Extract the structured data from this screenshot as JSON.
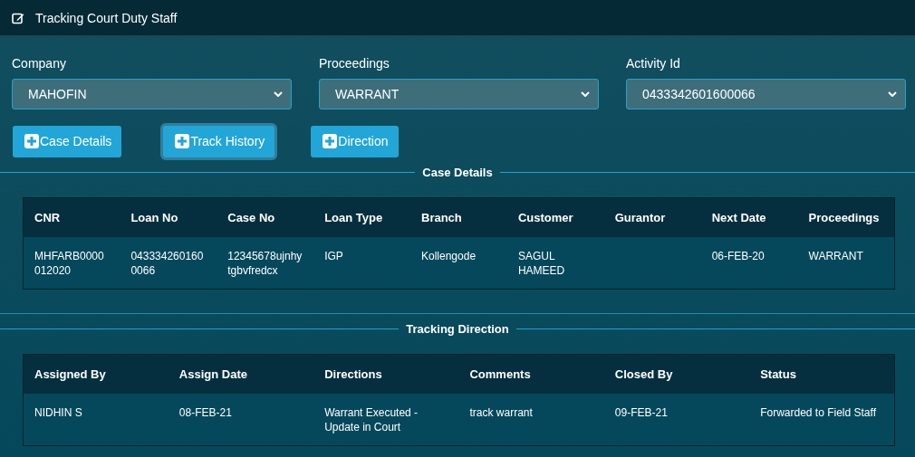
{
  "window": {
    "title": "Tracking Court Duty Staff"
  },
  "filters": [
    {
      "label": "Company",
      "value": "MAHOFIN"
    },
    {
      "label": "Proceedings",
      "value": "WARRANT"
    },
    {
      "label": "Activity Id",
      "value": "0433342601600066"
    }
  ],
  "buttons": [
    {
      "label": "Case Details",
      "focused": false
    },
    {
      "label": "Track History",
      "focused": true
    },
    {
      "label": "Direction",
      "focused": false
    }
  ],
  "case_details": {
    "title": "Case Details",
    "columns": [
      "CNR",
      "Loan No",
      "Case No",
      "Loan Type",
      "Branch",
      "Customer",
      "Gurantor",
      "Next Date",
      "Proceedings"
    ],
    "rows": [
      [
        "MHFARB0000012020",
        "0433342601600066",
        "12345678ujnhytgbvfredcx",
        "IGP",
        "Kollengode",
        "SAGUL HAMEED",
        "",
        "06-FEB-20",
        "WARRANT"
      ]
    ]
  },
  "tracking_direction": {
    "title": "Tracking Direction",
    "columns": [
      "Assigned By",
      "Assign Date",
      "Directions",
      "Comments",
      "Closed By",
      "Status"
    ],
    "rows": [
      [
        "NIDHIN S",
        "08-FEB-21",
        "Warrant Executed - Update in Court",
        "track warrant",
        "09-FEB-21",
        "Forwarded to Field Staff"
      ]
    ]
  }
}
